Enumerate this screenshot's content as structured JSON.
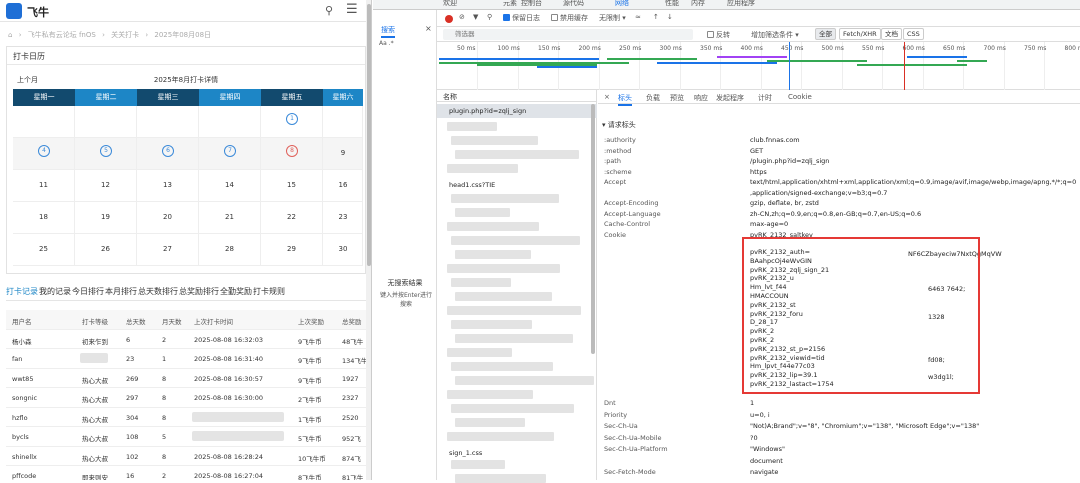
{
  "site": {
    "name": "飞牛",
    "search_icon": "search-icon",
    "menu_icon": "menu-icon"
  },
  "breadcrumb": [
    "飞牛私有云论坛 fnOS",
    "关关打卡",
    "2025年08月08日"
  ],
  "calendar": {
    "panel_title": "打卡日历",
    "prev_label": "上个月",
    "month_title": "2025年8月打卡详情",
    "weekdays": [
      "星期一",
      "星期二",
      "星期三",
      "星期四",
      "星期五",
      "星期六"
    ],
    "weeks": [
      [
        "",
        "",
        "",
        "",
        "1",
        ""
      ],
      [
        "4",
        "5",
        "6",
        "7",
        "8",
        "9"
      ],
      [
        "11",
        "12",
        "13",
        "14",
        "15",
        "16"
      ],
      [
        "18",
        "19",
        "20",
        "21",
        "22",
        "23"
      ],
      [
        "25",
        "26",
        "27",
        "28",
        "29",
        "30"
      ]
    ],
    "checked_days": [
      "1",
      "4",
      "5",
      "6",
      "7",
      "8"
    ],
    "highlight_day": "8"
  },
  "record_tabs": [
    "打卡记录",
    "我的记录",
    "今日排行",
    "本月排行",
    "总天数排行",
    "总奖励排行",
    "全勤奖励",
    "打卡规则"
  ],
  "rank_table": {
    "headers": [
      "用户名",
      "打卡等级",
      "总天数",
      "月天数",
      "上次打卡时间",
      "上次奖励",
      "总奖励"
    ],
    "rows": [
      [
        "杨小森",
        "初来乍到",
        "6",
        "2",
        "2025-08-08 16:32:03",
        "9飞牛币",
        "48飞牛"
      ],
      [
        "fan",
        "",
        "23",
        "1",
        "2025-08-08 16:31:40",
        "9飞牛币",
        "134飞牛"
      ],
      [
        "wwt85",
        "热心大叔",
        "269",
        "8",
        "2025-08-08 16:30:57",
        "9飞牛币",
        "1927"
      ],
      [
        "songnic",
        "热心大叔",
        "297",
        "8",
        "2025-08-08 16:30:00",
        "2飞牛币",
        "2327"
      ],
      [
        "hzflo",
        "热心大叔",
        "304",
        "8",
        "",
        "1飞牛币",
        "2520"
      ],
      [
        "bycls",
        "热心大叔",
        "108",
        "5",
        "",
        "5飞牛币",
        "952飞"
      ],
      [
        "shinellx",
        "热心大叔",
        "102",
        "8",
        "2025-08-08 16:28:24",
        "10飞牛币",
        "874飞"
      ],
      [
        "pffcode",
        "即来则安",
        "16",
        "2",
        "2025-08-08 16:27:04",
        "8飞牛币",
        "81飞牛"
      ],
      [
        "gxaxy",
        "热心大叔",
        "289",
        "8",
        "",
        "6飞牛币",
        "2276"
      ]
    ]
  },
  "devtools": {
    "top_tabs": [
      "欢迎",
      "元素",
      "控制台",
      "源代码",
      "网络",
      "性能",
      "内存",
      "应用程序"
    ],
    "active_tab": "网络",
    "search_tab_label": "搜索",
    "search_options": "Aa .*",
    "no_result": "无搜索结果",
    "no_result_hint": "键入并按Enter进行搜索",
    "toolbar": {
      "preserve_log": "保留日志",
      "disable_cache": "禁用缓存",
      "throttle": "无限制"
    },
    "filter": {
      "placeholder": "筛选器",
      "invert": "反转",
      "more_filters": "增加筛选条件",
      "types": [
        "全部",
        "Fetch/XHR",
        "文档",
        "CSS"
      ]
    },
    "timeline_ticks": [
      "50 ms",
      "100 ms",
      "150 ms",
      "200 ms",
      "250 ms",
      "300 ms",
      "350 ms",
      "400 ms",
      "450 ms",
      "500 ms",
      "550 ms",
      "600 ms",
      "650 ms",
      "700 ms",
      "750 ms",
      "800 ms"
    ],
    "names_header": "名称",
    "requests": [
      "plugin.php?id=zqlj_sign",
      "head1.css?TIE",
      "sign_1.css"
    ],
    "detail_tabs": [
      "标头",
      "负载",
      "预览",
      "响应",
      "发起程序",
      "计时",
      "Cookie"
    ],
    "active_detail_tab": "标头",
    "section_title": "请求标头",
    "headers": [
      {
        "k": ":authority",
        "v": "club.fnnas.com"
      },
      {
        "k": ":method",
        "v": "GET"
      },
      {
        "k": ":path",
        "v": "/plugin.php?id=zqlj_sign"
      },
      {
        "k": ":scheme",
        "v": "https"
      },
      {
        "k": "Accept",
        "v": "text/html,application/xhtml+xml,application/xml;q=0.9,image/avif,image/webp,image/apng,*/*;q=0"
      },
      {
        "k": "",
        "v": ",application/signed-exchange;v=b3;q=0.7"
      },
      {
        "k": "Accept-Encoding",
        "v": "gzip, deflate, br, zstd"
      },
      {
        "k": "Accept-Language",
        "v": "zh-CN,zh;q=0.9,en;q=0.8,en-GB;q=0.7,en-US;q=0.6"
      },
      {
        "k": "Cache-Control",
        "v": "max-age=0"
      },
      {
        "k": "Cookie",
        "v": "pvRK_2132_saltkey"
      }
    ],
    "cookie_lines": [
      "pvRK_2132_saltkey",
      "pvRK_2132_auth=",
      "BAahpcOj4eWvGIN",
      "pvRK_2132_zqlj_sign_21",
      "pvRK_2132_u",
      "Hm_lvt_f44",
      "HMACCOUN",
      "pvRK_2132_st",
      "pvRK_2132_foru",
      "D_28_17",
      "pvRK_2",
      "pvRK_2",
      "pvRK_2132_st_p=2156",
      "pvRK_2132_viewid=tid",
      "Hm_lpvt_f44e77c03",
      "pvRK_2132_lip=39.1",
      "pvRK_2132_lastact=1754"
    ],
    "cookie_right_fragments": [
      "NF6CZbayeciw7NxtQgMqVW",
      "6463 7642;",
      "1328",
      "fd08;",
      "w3dg1l;"
    ],
    "after_headers": [
      {
        "k": "Dnt",
        "v": "1"
      },
      {
        "k": "Priority",
        "v": "u=0, i"
      },
      {
        "k": "Sec-Ch-Ua",
        "v": "\"Not)A;Brand\";v=\"8\", \"Chromium\";v=\"138\", \"Microsoft Edge\";v=\"138\""
      },
      {
        "k": "Sec-Ch-Ua-Mobile",
        "v": "?0"
      },
      {
        "k": "Sec-Ch-Ua-Platform",
        "v": "\"Windows\""
      },
      {
        "k": "",
        "v": "document"
      },
      {
        "k": "Sec-Fetch-Mode",
        "v": "navigate"
      }
    ],
    "colors": {
      "accent": "#1a73e8",
      "highlight_box": "#e53935"
    }
  }
}
